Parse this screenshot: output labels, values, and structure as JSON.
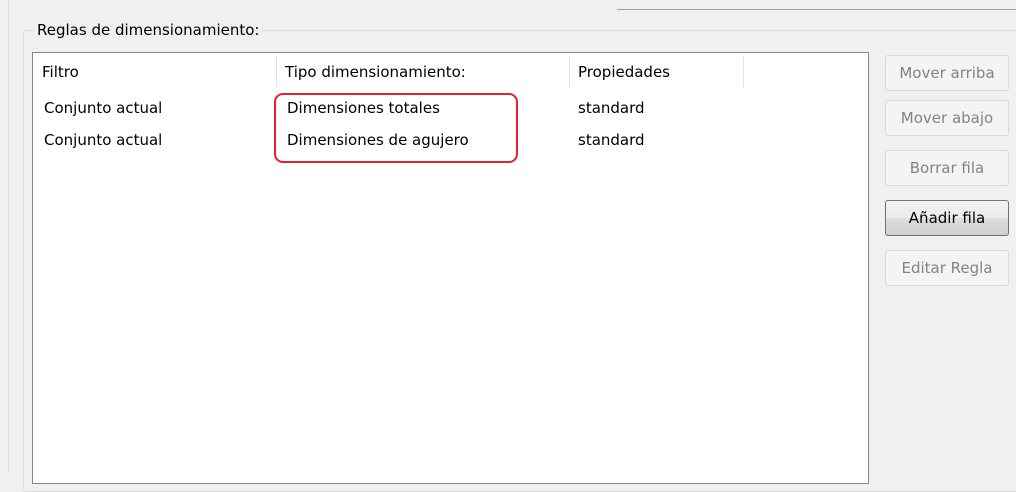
{
  "group": {
    "title": "Reglas de dimensionamiento:"
  },
  "table": {
    "columns": [
      "Filtro",
      "Tipo dimensionamiento:",
      "Propiedades",
      ""
    ],
    "rows": [
      [
        "Conjunto actual",
        "Dimensiones totales",
        "standard"
      ],
      [
        "Conjunto actual",
        "Dimensiones de agujero",
        "standard"
      ]
    ]
  },
  "buttons": {
    "move_up": "Mover arriba",
    "move_down": "Mover abajo",
    "delete_row": "Borrar fila",
    "add_row": "Añadir fila",
    "edit_rule": "Editar Regla"
  },
  "colors": {
    "highlight": "#e0242b",
    "disabled_text": "#838383",
    "border": "#828790"
  }
}
